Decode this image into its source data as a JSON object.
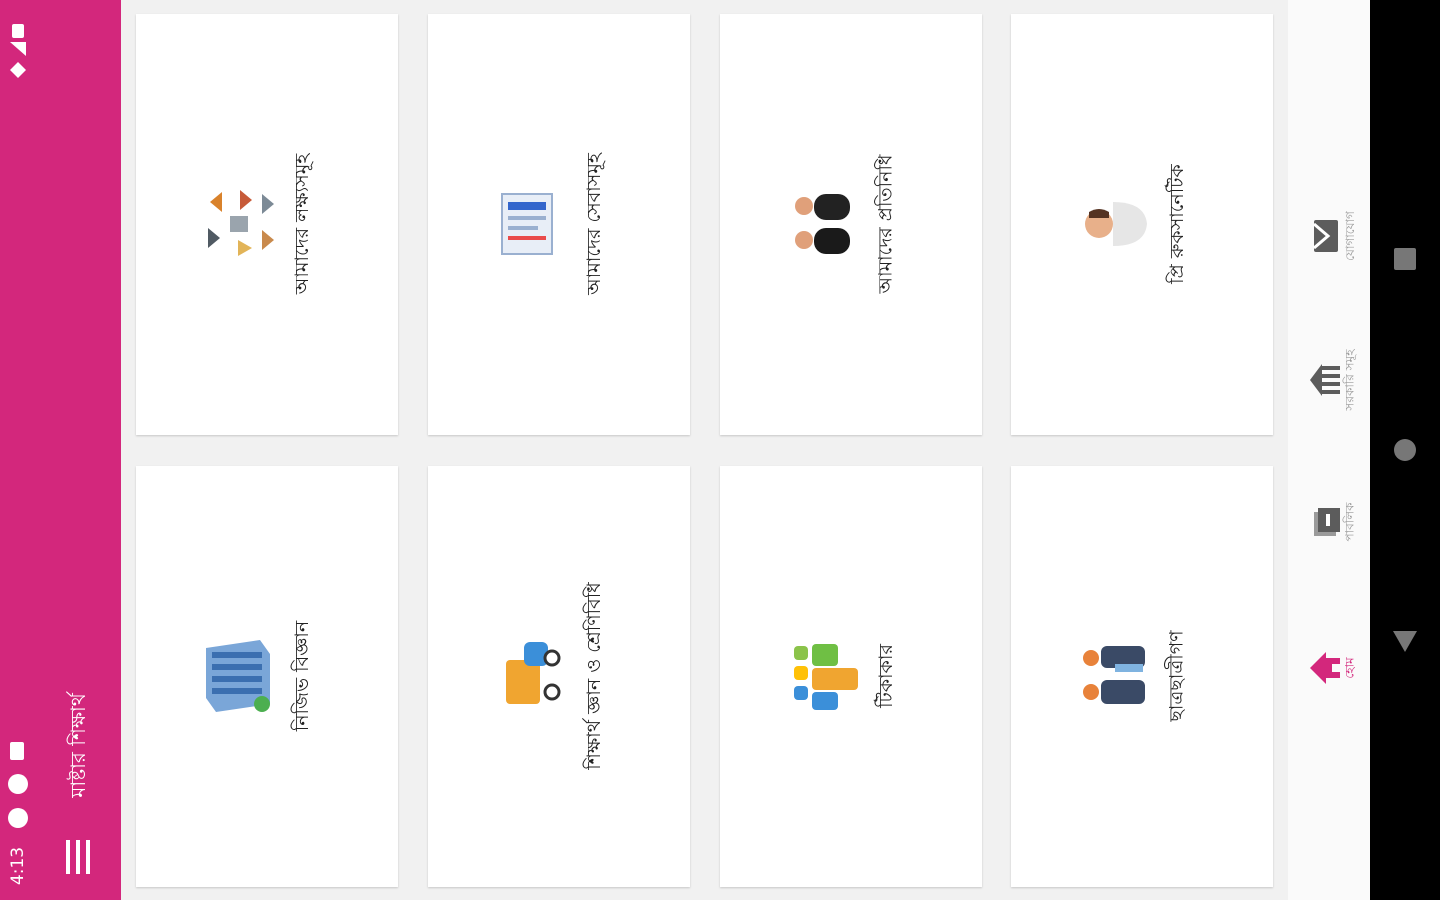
{
  "app": {
    "title": "মাষ্টার শিক্ষার্থ"
  },
  "status_bar": {
    "time": "4:13"
  },
  "cards": [
    {
      "label": "আমাদের লক্ষ্যসমূহ",
      "icon": "goals-icon"
    },
    {
      "label": "আমাদের সেবাসমূহ",
      "icon": "services-icon"
    },
    {
      "label": "আমাদের প্রতিনিধি",
      "icon": "representatives-icon"
    },
    {
      "label": "প্রি রুকসানেটিক",
      "icon": "person-icon"
    },
    {
      "label": "নিজিভ বিজ্ঞান",
      "icon": "building-icon"
    },
    {
      "label": "শিক্ষার্থ জ্ঞান ও শ্রেণিবিধি",
      "icon": "vehicle-icon"
    },
    {
      "label": "টিকাকার",
      "icon": "puzzle-icon"
    },
    {
      "label": "ছাত্রছাত্রীগণ",
      "icon": "students-icon"
    }
  ],
  "bottom_nav": [
    {
      "label": "যোগাযোগ",
      "icon": "mail-icon"
    },
    {
      "label": "সরকারি সমূহ",
      "icon": "institution-icon"
    },
    {
      "label": "পাবলিক",
      "icon": "page-icon"
    },
    {
      "label": "হোম",
      "icon": "home-icon",
      "active": true
    }
  ],
  "colors": {
    "accent": "#d3277c",
    "background": "#f1f1f1",
    "card": "#ffffff",
    "system_bar": "#000000"
  }
}
